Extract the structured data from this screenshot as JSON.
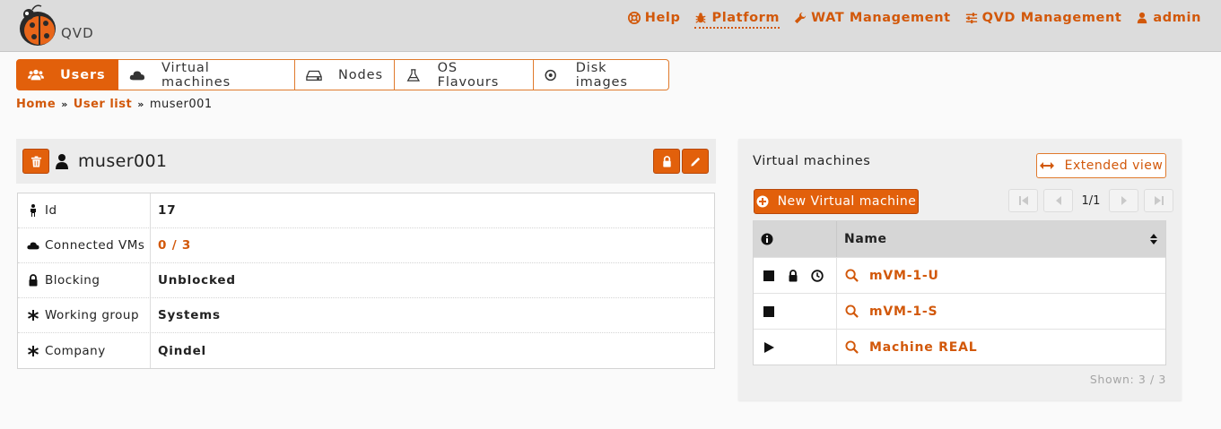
{
  "header": {
    "logo_text": "QVD",
    "nav": [
      {
        "label": "Help",
        "icon": "lifebuoy-icon"
      },
      {
        "label": "Platform",
        "icon": "bug-icon",
        "active": true
      },
      {
        "label": "WAT Management",
        "icon": "wrench-icon"
      },
      {
        "label": "QVD Management",
        "icon": "sliders-icon"
      },
      {
        "label": "admin",
        "icon": "user-icon"
      }
    ]
  },
  "tabs": [
    {
      "label": "Users",
      "icon": "users-icon",
      "active": true
    },
    {
      "label": "Virtual machines",
      "icon": "cloud-icon"
    },
    {
      "label": "Nodes",
      "icon": "hdd-icon"
    },
    {
      "label": "OS Flavours",
      "icon": "flask-icon"
    },
    {
      "label": "Disk images",
      "icon": "disc-icon"
    }
  ],
  "breadcrumb": {
    "home": "Home",
    "list": "User list",
    "current": "muser001",
    "separator": "»"
  },
  "user": {
    "name": "muser001",
    "details": [
      {
        "key": "Id",
        "value": "17",
        "icon": "male-icon"
      },
      {
        "key": "Connected VMs",
        "value": "0 / 3",
        "icon": "cloud-icon",
        "link": true
      },
      {
        "key": "Blocking",
        "value": "Unblocked",
        "icon": "lock-icon"
      },
      {
        "key": "Working group",
        "value": "Systems",
        "icon": "asterisk-icon"
      },
      {
        "key": "Company",
        "value": "Qindel",
        "icon": "asterisk-icon"
      }
    ]
  },
  "vm_panel": {
    "title": "Virtual machines",
    "extended_view": "Extended view",
    "new_vm": "New Virtual machine",
    "pager": "1/1",
    "column_name": "Name",
    "rows": [
      {
        "name": "mVM-1-U",
        "state": "stopped",
        "blocked": true,
        "expiring": true
      },
      {
        "name": "mVM-1-S",
        "state": "stopped",
        "blocked": false,
        "expiring": false
      },
      {
        "name": "Machine REAL",
        "state": "running",
        "blocked": false,
        "expiring": false
      }
    ],
    "shown": "Shown: 3 / 3"
  },
  "colors": {
    "accent": "#e2600b",
    "link": "#d2580a",
    "header_bg": "#dcdcdc"
  }
}
